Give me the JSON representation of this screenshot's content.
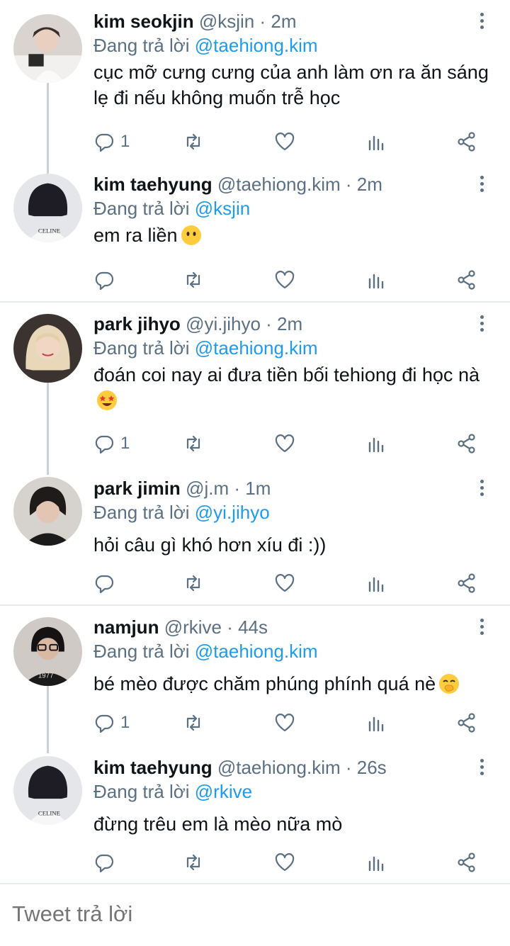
{
  "tweets": [
    {
      "name": "kim seokjin",
      "handle": "@ksjin",
      "time": "· 2m",
      "reply_prefix": "Đang trả lời ",
      "reply_to": "@taehiong.kim",
      "body": "cục mỡ cưng cưng của anh làm ơn ra ăn sáng lẹ đi nếu không muốn trễ học",
      "reply_count": "1",
      "emoji": ""
    },
    {
      "name": "kim taehyung",
      "handle": "@taehiong.kim",
      "time": "· 2m",
      "reply_prefix": "Đang trả lời ",
      "reply_to": "@ksjin",
      "body": "em ra liền",
      "reply_count": "",
      "emoji": "no-mouth-face"
    },
    {
      "name": "park jihyo",
      "handle": "@yi.jihyo",
      "time": "· 2m",
      "reply_prefix": "Đang trả lời ",
      "reply_to": "@taehiong.kim",
      "body": "đoán coi nay ai đưa tiền bối tehiong đi học nà",
      "reply_count": "1",
      "emoji": "star-struck-face"
    },
    {
      "name": "park jimin",
      "handle": "@j.m",
      "time": "· 1m",
      "reply_prefix": "Đang trả lời ",
      "reply_to": "@yi.jihyo",
      "body": "hỏi câu gì khó hơn xíu đi :))",
      "reply_count": "",
      "emoji": ""
    },
    {
      "name": "namjun",
      "handle": "@rkive",
      "time": "· 44s",
      "reply_prefix": "Đang trả lời ",
      "reply_to": "@taehiong.kim",
      "body": "bé mèo được chăm phúng phính quá nè",
      "reply_count": "1",
      "emoji": "face-with-hand-over-mouth"
    },
    {
      "name": "kim taehyung",
      "handle": "@taehiong.kim",
      "time": "· 26s",
      "reply_prefix": "Đang trả lời ",
      "reply_to": "@rkive",
      "body": "đừng trêu em là mèo nữa mò",
      "reply_count": "",
      "emoji": ""
    }
  ],
  "compose": {
    "placeholder": "Tweet trả lời"
  },
  "colors": {
    "link": "#1d9bf0",
    "secondary": "#5b7083",
    "divider": "#e6ecf0"
  },
  "icons": [
    "reply-icon",
    "retweet-icon",
    "like-icon",
    "analytics-icon",
    "share-icon",
    "more-icon"
  ]
}
